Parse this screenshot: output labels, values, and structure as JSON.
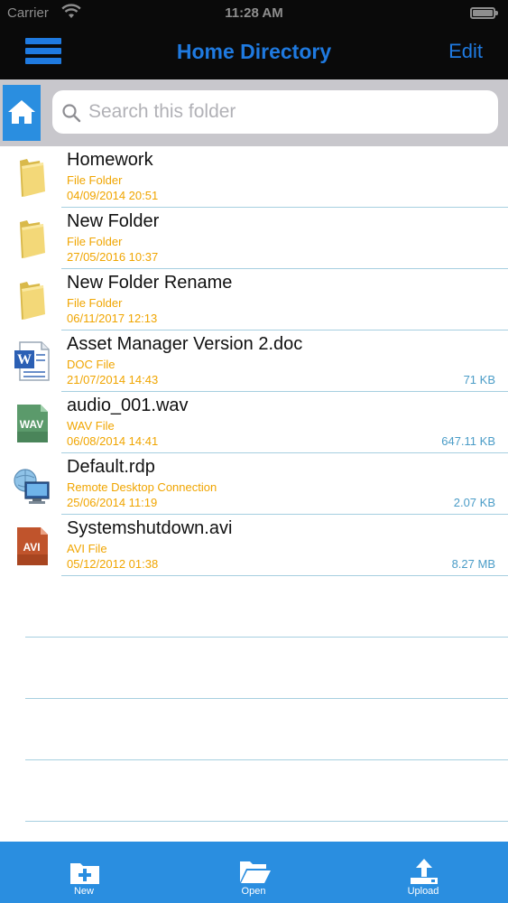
{
  "status_bar": {
    "carrier": "Carrier",
    "time": "11:28 AM"
  },
  "nav": {
    "title": "Home Directory",
    "edit_label": "Edit"
  },
  "search": {
    "placeholder": "Search this folder"
  },
  "files": [
    {
      "name": "Homework",
      "type": "File Folder",
      "date": "04/09/2014 20:51",
      "size": "",
      "icon": "folder-icon"
    },
    {
      "name": "New Folder",
      "type": "File Folder",
      "date": "27/05/2016 10:37",
      "size": "",
      "icon": "folder-icon"
    },
    {
      "name": "New Folder Rename",
      "type": "File Folder",
      "date": "06/11/2017 12:13",
      "size": "",
      "icon": "folder-icon"
    },
    {
      "name": "Asset Manager Version 2.doc",
      "type": "DOC File",
      "date": "21/07/2014 14:43",
      "size": "71 KB",
      "icon": "doc-file-icon"
    },
    {
      "name": "audio_001.wav",
      "type": "WAV File",
      "date": "06/08/2014 14:41",
      "size": "647.11 KB",
      "icon": "wav-file-icon"
    },
    {
      "name": "Default.rdp",
      "type": "Remote Desktop Connection",
      "date": "25/06/2014 11:19",
      "size": "2.07 KB",
      "icon": "rdp-file-icon"
    },
    {
      "name": "Systemshutdown.avi",
      "type": "AVI File",
      "date": "05/12/2012 01:38",
      "size": "8.27 MB",
      "icon": "avi-file-icon"
    }
  ],
  "icon_labels": {
    "wav": "WAV",
    "avi": "AVI"
  },
  "toolbar": {
    "new_label": "New",
    "open_label": "Open",
    "upload_label": "Upload"
  },
  "colors": {
    "accent": "#1f7ae0",
    "toolbar": "#2a8ee0",
    "meta_text": "#f0a500",
    "size_text": "#4a9cc7",
    "separator": "#a6cfe0"
  }
}
